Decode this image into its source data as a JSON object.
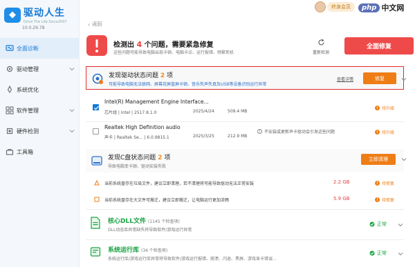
{
  "app": {
    "name": "驱动人生",
    "slogan": "Drive The Life Since2007",
    "version": "10.0.29.78"
  },
  "sidebar": {
    "items": [
      {
        "label": "全面诊断",
        "icon": "stethoscope-icon",
        "active": true
      },
      {
        "label": "驱动管理",
        "icon": "gear-icon",
        "active": false
      },
      {
        "label": "系统优化",
        "icon": "rocket-icon",
        "active": false
      },
      {
        "label": "软件管理",
        "icon": "apps-icon",
        "active": false
      },
      {
        "label": "硬件检测",
        "icon": "chip-icon",
        "active": false
      },
      {
        "label": "工具箱",
        "icon": "toolbox-icon",
        "active": false
      }
    ]
  },
  "topbar": {
    "back_label": "返回",
    "vip_label": "终身会员",
    "watermark_badge": "php",
    "watermark_site": "中文网"
  },
  "alert": {
    "title_prefix": "检测出",
    "count": "4",
    "title_suffix": "个问题，需要紧急修复",
    "subtitle": "这些问题可能导致电脑出现卡顿、电脑卡诊、运行报错、频繁死机",
    "redetect_label": "重新检测",
    "fix_all_label": "全面修复"
  },
  "driver_section": {
    "title_prefix": "发现驱动状态问题",
    "count": "2",
    "title_suffix": "项",
    "subtitle": "可能导致电脑无法联网、屏幕花屏蓝屏卡顿、音乐失声失真及USB等设备识别运行异常",
    "detail_link": "查看详情",
    "fix_label": "修复",
    "items": [
      {
        "name": "Intel(R) Management Engine Interface...",
        "meta": "芯片组 | Intel | 2517.8.1.0",
        "date": "2025/4/24",
        "size": "509.4 MB",
        "checked": true,
        "status": "待升级",
        "note": ""
      },
      {
        "name": "Realtek High Definition audio",
        "meta": "声卡 | Realtek Se... | 6.0.9815.1",
        "date": "2025/3/25",
        "size": "212.9 MB",
        "checked": false,
        "status": "待升级",
        "note": "不安装或更新声卡驱动会引发这些问题"
      }
    ]
  },
  "disk_section": {
    "title_prefix": "发现C盘状态问题",
    "count": "2",
    "title_suffix": "项",
    "subtitle": "导致电脑变卡顿、驱动安装失败",
    "clean_label": "立即清理",
    "items": [
      {
        "text": "当前系统盘存在垃圾文件，建议立即清理，若不清理将可能导致驱动无法正常安装",
        "amount": "2.2 GB",
        "status": "待修复"
      },
      {
        "text": "当前系统盘存在大文件可搬迁，建议立即搬迁，让电脑运行更加流畅",
        "amount": "5.9 GB",
        "status": "待修复"
      }
    ]
  },
  "dll_section": {
    "title": "核心DLL文件",
    "count_label": "(1145 个检查项)",
    "subtitle": "DLL动态库异常缺失将导致软件/游戏运行异常",
    "status": "正常"
  },
  "runtime_section": {
    "title": "系统运行库",
    "count_label": "(34 个检查项)",
    "subtitle": "系统运行库/游戏运行库异常将导致软件/游戏运行报错、崩溃、闪退、黑屏、游戏显卡错误...",
    "status": "正常"
  },
  "colors": {
    "brand_blue": "#1479d6",
    "alert_red": "#ef4a4a",
    "warn_orange": "#ee7d16",
    "ok_green": "#1aa343",
    "highlight_border": "#e42b2b"
  }
}
